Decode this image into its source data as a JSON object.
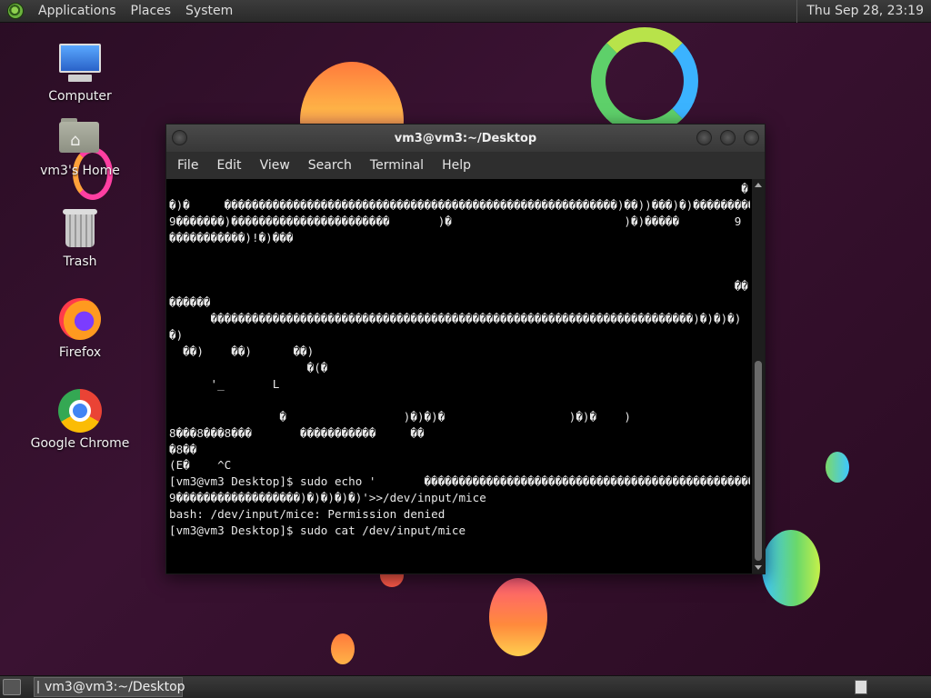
{
  "top_panel": {
    "menus": [
      "Applications",
      "Places",
      "System"
    ],
    "clock": "Thu Sep 28, 23:19"
  },
  "desktop_icons": [
    {
      "label": "Computer",
      "icon": "computer-icon"
    },
    {
      "label": "vm3's Home",
      "icon": "home-folder-icon"
    },
    {
      "label": "Trash",
      "icon": "trash-icon"
    },
    {
      "label": "Firefox",
      "icon": "firefox-icon"
    },
    {
      "label": "Google Chrome",
      "icon": "chrome-icon"
    }
  ],
  "terminal": {
    "title": "vm3@vm3:~/Desktop",
    "menu": [
      "File",
      "Edit",
      "View",
      "Search",
      "Terminal",
      "Help"
    ],
    "lines": [
      "                                                                                   �",
      "�)�     ���������������������������������������������������������)��))���)�)�����������",
      "9�������)�����������������������       )�                         )�)�����        9",
      "�����������)!�)���",
      "",
      "",
      "                                                                                  ��",
      "������",
      "      ����������������������������������������������������������������������)�)�)�)",
      "�)",
      "  ��)    ��)      ��)",
      "                    �(�",
      "      '_       L",
      "",
      "                �                 )�)�)�                  )�)�    )",
      "8���8���8���       �����������     ��                                                9",
      "�8��",
      "(E�    ^C",
      "[vm3@vm3 Desktop]$ sudo echo '       ��������������������������������������������������",
      "9������������������)�)�)�)�)'>>/dev/input/mice",
      "bash: /dev/input/mice: Permission denied",
      "[vm3@vm3 Desktop]$ sudo cat /dev/input/mice"
    ]
  },
  "taskbar": {
    "task_label": "vm3@vm3:~/Desktop"
  }
}
